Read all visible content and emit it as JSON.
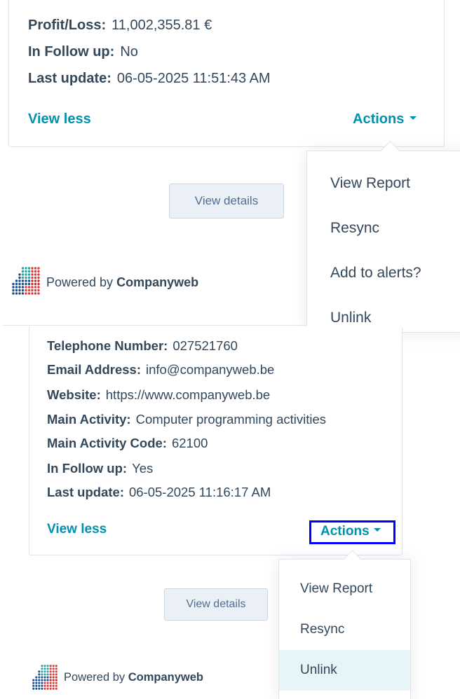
{
  "top_card": {
    "fields": [
      {
        "label": "Profit/Loss:",
        "value": "11,002,355.81 €"
      },
      {
        "label": "In Follow up:",
        "value": "No"
      },
      {
        "label": "Last update:",
        "value": "06-05-2025 11:51:43 AM"
      }
    ],
    "view_less": "View less",
    "actions": "Actions"
  },
  "top_menu": {
    "items": [
      "View Report",
      "Resync",
      "Add to alerts?",
      "Unlink"
    ]
  },
  "top_view_details": "View details",
  "top_powered": {
    "prefix": "Powered by",
    "brand": "Companyweb"
  },
  "bottom_card": {
    "fields": [
      {
        "label": "Telephone Number:",
        "value": "027521760"
      },
      {
        "label": "Email Address:",
        "value": "info@companyweb.be"
      },
      {
        "label": "Website:",
        "value": "https://www.companyweb.be"
      },
      {
        "label": "Main Activity:",
        "value": "Computer programming activities"
      },
      {
        "label": "Main Activity Code:",
        "value": "62100"
      },
      {
        "label": "In Follow up:",
        "value": "Yes"
      },
      {
        "label": "Last update:",
        "value": "06-05-2025 11:16:17 AM"
      }
    ],
    "view_less": "View less",
    "actions": "Actions"
  },
  "bottom_menu": {
    "items": [
      "View Report",
      "Resync",
      "Unlink"
    ],
    "highlighted": "Unlink"
  },
  "bottom_view_details": "View details",
  "bottom_powered": {
    "prefix": "Powered by",
    "brand": "Companyweb"
  },
  "colors": {
    "link": "#0091ae",
    "text": "#33475b",
    "button_bg": "#eaf0f6",
    "highlight_bg": "#e5f5f8",
    "focus_outline": "#0000ff"
  }
}
